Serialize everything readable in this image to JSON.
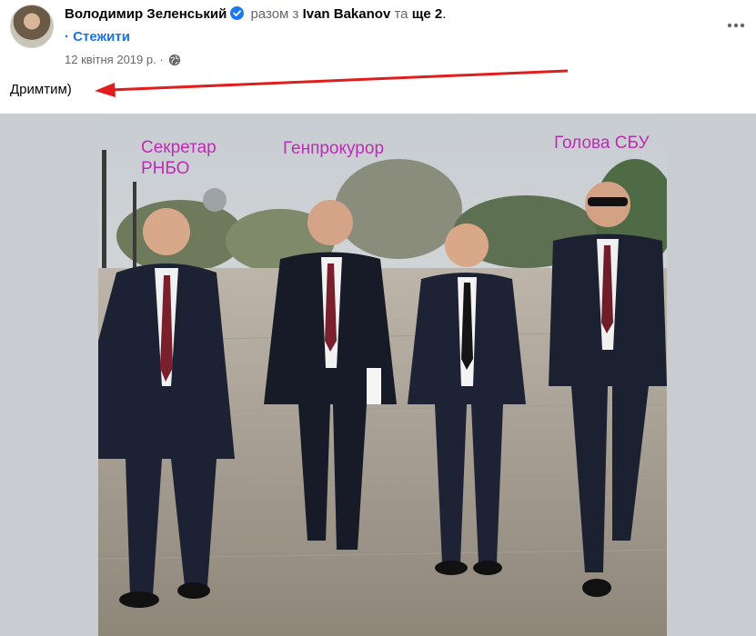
{
  "post": {
    "author": "Володимир Зеленський",
    "with_prefix": "разом з",
    "tagged_person": "Ivan Bakanov",
    "and_text": "та",
    "others": "ще 2",
    "period": ".",
    "follow_dot": "·",
    "follow_label": "Стежити",
    "date": "12 квітня 2019 р.",
    "date_dot": "·",
    "caption": "Дримтим)"
  },
  "photo": {
    "labels": {
      "secretary": "Секретар",
      "rnbo": "РНБО",
      "prosecutor": "Генпрокурор",
      "sbu_head": "Голова СБУ"
    },
    "label_color": "#c02bb5"
  },
  "colors": {
    "link_blue": "#1b74e4",
    "verified_blue": "#1877f2",
    "arrow_red": "#e01e1e",
    "muted": "#65676b"
  },
  "icons": {
    "verified": "verified-badge-icon",
    "privacy": "globe-icon",
    "more": "more-options-icon"
  }
}
